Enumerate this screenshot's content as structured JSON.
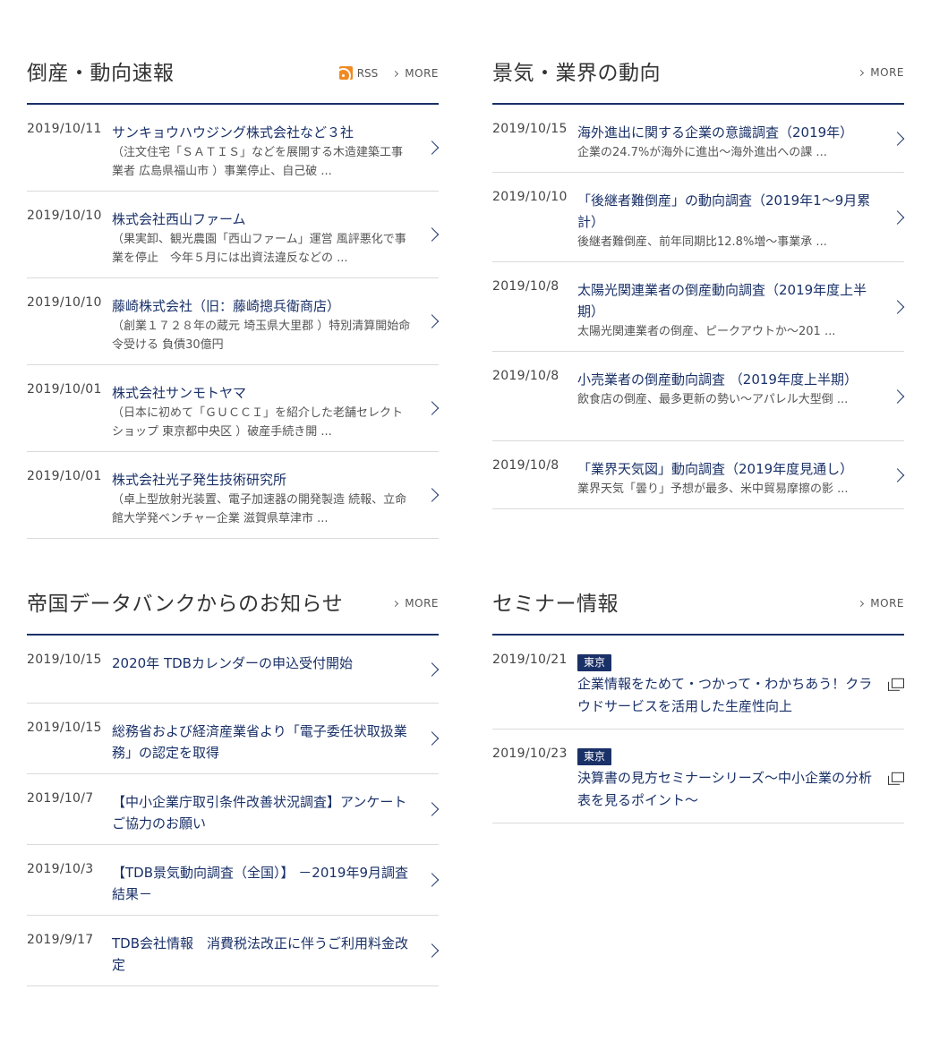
{
  "colors": {
    "accent": "#1a3168",
    "rss": "#f08a24",
    "divider": "#dadada"
  },
  "news": {
    "title": "倒産・動向速報",
    "rss_label": "RSS",
    "more_label": "MORE",
    "items": [
      {
        "date": "2019/10/11",
        "title": "サンキョウハウジング株式会社など３社",
        "desc": "（注文住宅「ＳＡＴＩＳ」などを展開する木造建築工事業者 広島県福山市 ）事業停止、自己破 ..."
      },
      {
        "date": "2019/10/10",
        "title": "株式会社西山ファーム",
        "desc": "（果実卸、観光農園「西山ファーム」運営 風評悪化で事業を停止　今年５月には出資法違反などの ..."
      },
      {
        "date": "2019/10/10",
        "title": "藤崎株式会社（旧：藤崎摠兵衛商店）",
        "desc": "（創業１７２８年の蔵元 埼玉県大里郡 ）特別清算開始命令受ける 負債30億円"
      },
      {
        "date": "2019/10/01",
        "title": "株式会社サンモトヤマ",
        "desc": "（日本に初めて「ＧＵＣＣＩ」を紹介した老舗セレクトショップ 東京都中央区 ）破産手続き開 ..."
      },
      {
        "date": "2019/10/01",
        "title": "株式会社光子発生技術研究所",
        "desc": "（卓上型放射光装置、電子加速器の開発製造 続報、立命館大学発ベンチャー企業 滋賀県草津市 ..."
      }
    ]
  },
  "trend": {
    "title": "景気・業界の動向",
    "more_label": "MORE",
    "items": [
      {
        "date": "2019/10/15",
        "title": "海外進出に関する企業の意識調査（2019年）",
        "desc": "企業の24.7%が海外に進出～海外進出への課 ..."
      },
      {
        "date": "2019/10/10",
        "title": "「後継者難倒産」の動向調査（2019年1～9月累計）",
        "desc": "後継者難倒産、前年同期比12.8%増～事業承 ..."
      },
      {
        "date": "2019/10/8",
        "title": "太陽光関連業者の倒産動向調査（2019年度上半期）",
        "desc": "太陽光関連業者の倒産、ピークアウトか～201 ..."
      },
      {
        "date": "2019/10/8",
        "title": "小売業者の倒産動向調査 （2019年度上半期）",
        "desc": "飲食店の倒産、最多更新の勢い～アパレル大型倒 ..."
      },
      {
        "date": "2019/10/8",
        "title": "「業界天気図」動向調査（2019年度見通し）",
        "desc": "業界天気「曇り」予想が最多、米中貿易摩擦の影 ..."
      }
    ]
  },
  "notice": {
    "title": "帝国データバンクからのお知らせ",
    "more_label": "MORE",
    "items": [
      {
        "date": "2019/10/15",
        "title": "2020年 TDBカレンダーの申込受付開始"
      },
      {
        "date": "2019/10/15",
        "title": "総務省および経済産業省より「電子委任状取扱業務」の認定を取得"
      },
      {
        "date": "2019/10/7",
        "title": "【中小企業庁取引条件改善状況調査】アンケートご協力のお願い"
      },
      {
        "date": "2019/10/3",
        "title": "【TDB景気動向調査（全国）】 －2019年9月調査結果－"
      },
      {
        "date": "2019/9/17",
        "title": "TDB会社情報　消費税法改正に伴うご利用料金改定"
      }
    ]
  },
  "seminar": {
    "title": "セミナー情報",
    "more_label": "MORE",
    "items": [
      {
        "date": "2019/10/21",
        "badge": "東京",
        "title": "企業情報をためて・つかって・わかちあう！クラウドサービスを活用した生産性向上",
        "icon": "external-window-icon"
      },
      {
        "date": "2019/10/23",
        "badge": "東京",
        "title": "決算書の見方セミナーシリーズ～中小企業の分析表を見るポイント～",
        "icon": "external-window-icon"
      }
    ]
  }
}
